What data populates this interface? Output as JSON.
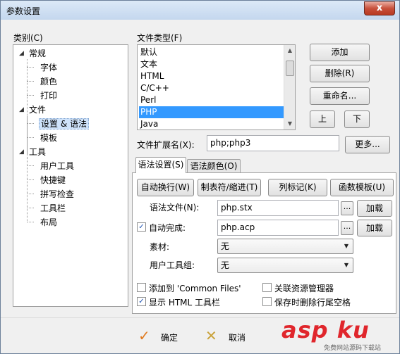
{
  "window": {
    "title": "参数设置",
    "close_glyph": "x"
  },
  "category_label": "类别(C)",
  "tree": [
    {
      "label": "常规",
      "expanded": true
    },
    {
      "label": "字体"
    },
    {
      "label": "颜色"
    },
    {
      "label": "打印"
    },
    {
      "label": "文件",
      "expanded": true
    },
    {
      "label": "设置 & 语法",
      "selected": true
    },
    {
      "label": "模板"
    },
    {
      "label": "工具",
      "expanded": true
    },
    {
      "label": "用户工具"
    },
    {
      "label": "快捷键"
    },
    {
      "label": "拼写检查"
    },
    {
      "label": "工具栏"
    },
    {
      "label": "布局"
    }
  ],
  "file_types": {
    "label": "文件类型(F)",
    "items": [
      "默认",
      "文本",
      "HTML",
      "C/C++",
      "Perl",
      "PHP",
      "Java"
    ],
    "selected": "PHP"
  },
  "type_buttons": {
    "add": "添加",
    "delete": "删除(R)",
    "rename": "重命名...",
    "up": "上",
    "down": "下"
  },
  "extension": {
    "label": "文件扩展名(X):",
    "value": "php;php3",
    "more": "更多..."
  },
  "tabs": {
    "syntax_settings": "语法设置(S)",
    "syntax_colors": "语法颜色(O)",
    "active": "syntax_settings"
  },
  "toolbar": {
    "wrap": "自动换行(W)",
    "tabs": "制表符/缩进(T)",
    "column": "列标记(K)",
    "func_template": "函数模板(U)"
  },
  "syntax_file": {
    "label": "语法文件(N):",
    "value": "php.stx",
    "browse": "...",
    "load": "加载"
  },
  "autocomplete": {
    "label": "自动完成:",
    "checked": true,
    "value": "php.acp",
    "browse": "...",
    "load": "加载"
  },
  "material": {
    "label": "素材:",
    "value": "无"
  },
  "user_tool_group": {
    "label": "用户工具组:",
    "value": "无"
  },
  "options": {
    "add_common": {
      "label": "添加到 'Common Files'",
      "checked": false
    },
    "link_explorer": {
      "label": "关联资源管理器",
      "checked": false
    },
    "show_html_toolbar": {
      "label": "显示 HTML 工具栏",
      "checked": true
    },
    "trim_trailing": {
      "label": "保存时删除行尾空格",
      "checked": false
    }
  },
  "footer": {
    "ok": "确定",
    "cancel": "取消"
  },
  "watermark": {
    "brand": "asp ku",
    "tagline": "免费网站源码下载站"
  },
  "colors": {
    "selection": "#3399ff",
    "ok_icon": "#e07a1f",
    "cancel_icon": "#c9a23a",
    "watermark": "#e0262c"
  }
}
